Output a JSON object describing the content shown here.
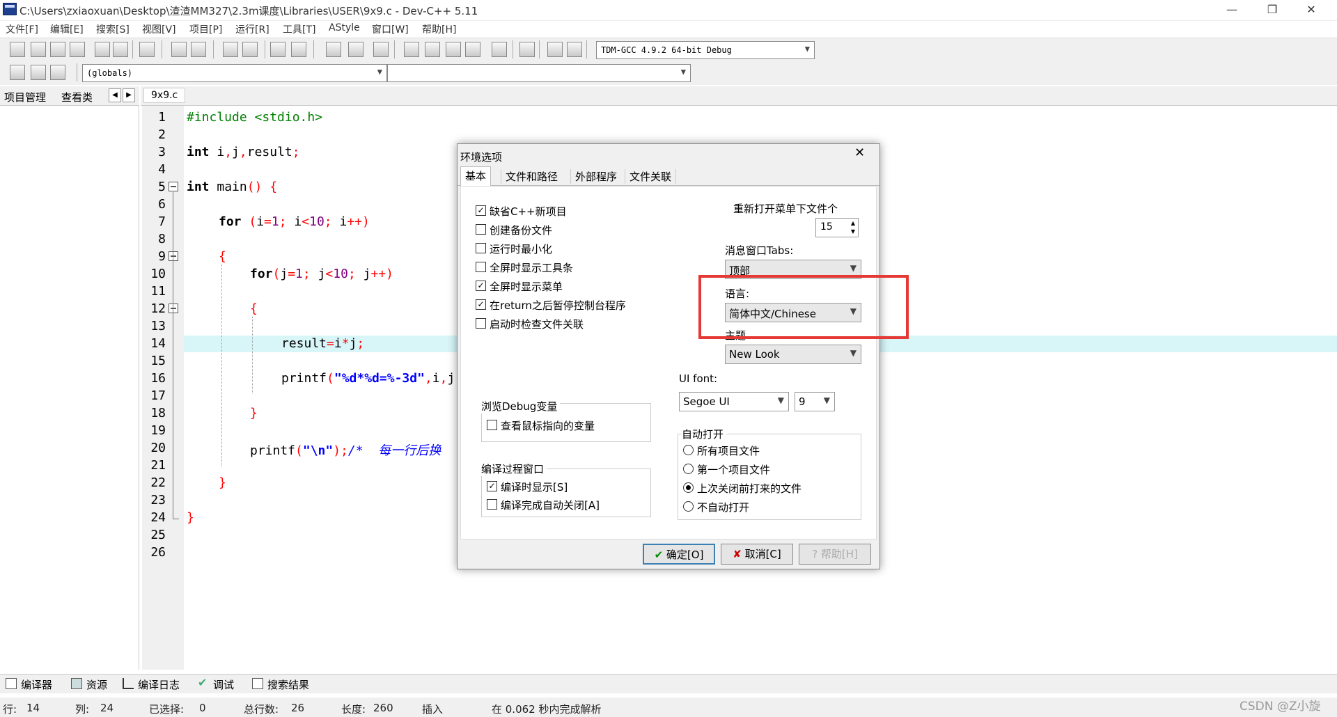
{
  "window": {
    "title": "C:\\Users\\zxiaoxuan\\Desktop\\渣渣MM327\\2.3m课度\\Libraries\\USER\\9x9.c - Dev-C++ 5.11",
    "minimize": "—",
    "restore": "❐",
    "close": "✕"
  },
  "menu": [
    "文件[F]",
    "编辑[E]",
    "搜索[S]",
    "视图[V]",
    "项目[P]",
    "运行[R]",
    "工具[T]",
    "AStyle",
    "窗口[W]",
    "帮助[H]"
  ],
  "toolbar": {
    "compiler": "TDM-GCC 4.9.2 64-bit Debug",
    "scope": "(globals)",
    "scope2": ""
  },
  "left_tabs": [
    "项目管理",
    "查看类"
  ],
  "editor": {
    "tab": "9x9.c",
    "line_numbers": [
      "1",
      "2",
      "3",
      "4",
      "5",
      "6",
      "7",
      "8",
      "9",
      "10",
      "11",
      "12",
      "13",
      "14",
      "15",
      "16",
      "17",
      "18",
      "19",
      "20",
      "21",
      "22",
      "23",
      "24",
      "25",
      "26"
    ],
    "lines": {
      "l1": "#include <stdio.h>",
      "l3a": "int",
      "l3b": " i",
      "l3c": ",",
      "l3d": "j",
      "l3e": ",",
      "l3f": "result",
      "l3g": ";",
      "l5a": "int",
      "l5b": " main",
      "l5c": "()",
      "l5d": " {",
      "l7a": "for",
      "l7b": " (",
      "l7c": "i",
      "l7d": "=",
      "l7e": "1",
      "l7f": ";",
      "l7g": " i",
      "l7h": "<",
      "l7i": "10",
      "l7j": ";",
      "l7k": " i",
      "l7l": "++",
      "l7m": ")",
      "l9": "{",
      "l10a": "for",
      "l10b": "(",
      "l10c": "j",
      "l10d": "=",
      "l10e": "1",
      "l10f": ";",
      "l10g": " j",
      "l10h": "<",
      "l10i": "10",
      "l10j": ";",
      "l10k": " j",
      "l10l": "++",
      "l10m": ")",
      "l12": "{",
      "l14a": "result",
      "l14b": "=",
      "l14c": "i",
      "l14d": "*",
      "l14e": "j",
      "l14f": ";",
      "l16a": "printf",
      "l16b": "(",
      "l16c": "\"%d*%d=%-3d\"",
      "l16d": ",",
      "l16e": "i",
      "l16f": ",",
      "l16g": "j",
      "l18": "}",
      "l20a": "printf",
      "l20b": "(",
      "l20c": "\"\\n\"",
      "l20d": ");",
      "l20e": "/*  每一行后换",
      "l22": "}",
      "l24": "}"
    }
  },
  "dialog": {
    "title": "环境选项",
    "close": "✕",
    "tabs": [
      "基本",
      "文件和路径",
      "外部程序",
      "文件关联"
    ],
    "checks": [
      {
        "label": "缺省C++新项目",
        "checked": true
      },
      {
        "label": "创建备份文件",
        "checked": false
      },
      {
        "label": "运行时最小化",
        "checked": false
      },
      {
        "label": "全屏时显示工具条",
        "checked": false
      },
      {
        "label": "全屏时显示菜单",
        "checked": true
      },
      {
        "label": "在return之后暂停控制台程序",
        "checked": true
      },
      {
        "label": "启动时检查文件关联",
        "checked": false
      }
    ],
    "reopen_label": "重新打开菜单下文件个",
    "reopen_value": "15",
    "msg_tabs_label": "消息窗口Tabs:",
    "msg_tabs_value": "顶部",
    "lang_label": "语言:",
    "lang_value": "简体中文/Chinese",
    "theme_label": "主题",
    "theme_value": "New Look",
    "uifont_label": "UI font:",
    "uifont_value": "Segoe UI",
    "uifont_size": "9",
    "debug_group": "浏览Debug变量",
    "debug_check": "查看鼠标指向的变量",
    "compile_group": "编译过程窗口",
    "compile_check1": "编译时显示[S]",
    "compile_check2": "编译完成自动关闭[A]",
    "autoopen_group": "自动打开",
    "radios": [
      {
        "label": "所有项目文件",
        "on": false
      },
      {
        "label": "第一个项目文件",
        "on": false
      },
      {
        "label": "上次关闭前打来的文件",
        "on": true
      },
      {
        "label": "不自动打开",
        "on": false
      }
    ],
    "ok": "确定[O]",
    "cancel": "取消[C]",
    "help": "帮助[H]",
    "highlight_color": "#e53935"
  },
  "bottom_tabs": [
    "编译器",
    "资源",
    "编译日志",
    "调试",
    "搜索结果"
  ],
  "status": {
    "row_label": "行:",
    "row": "14",
    "col_label": "列:",
    "col": "24",
    "sel_label": "已选择:",
    "sel": "0",
    "total_label": "总行数:",
    "total": "26",
    "len_label": "长度:",
    "len": "260",
    "mode": "插入",
    "parse": "在 0.062 秒内完成解析"
  },
  "watermark": "CSDN @Z小旋"
}
